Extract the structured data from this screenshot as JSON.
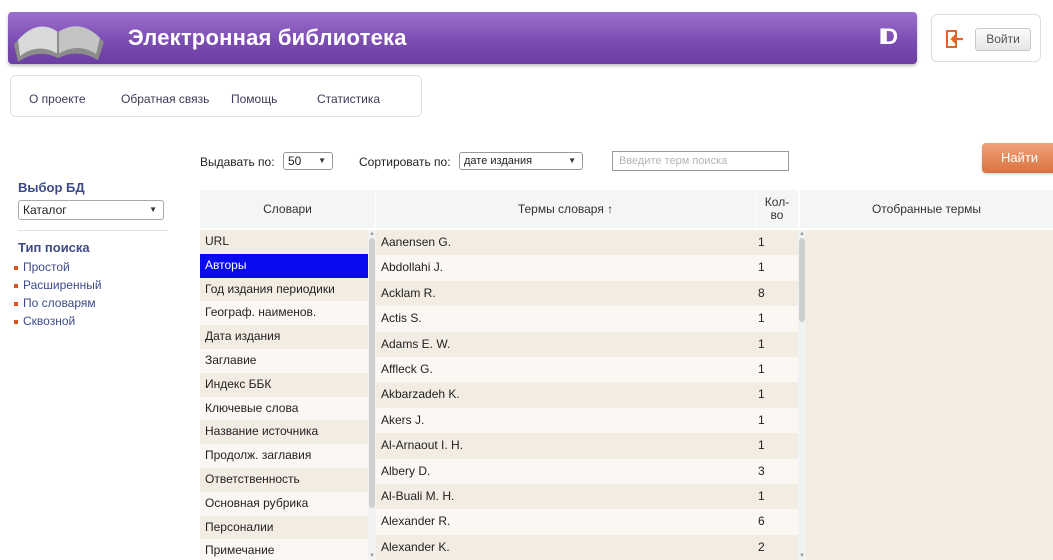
{
  "header": {
    "title": "Электронная библиотека",
    "brand_mark": "ID",
    "login_label": "Войти"
  },
  "nav": {
    "items": [
      "О проекте",
      "Обратная связь",
      "Помощь",
      "Статистика"
    ]
  },
  "sidebar": {
    "db_heading": "Выбор БД",
    "db_selected": "Каталог",
    "search_type_heading": "Тип поиска",
    "search_types": [
      "Простой",
      "Расширенный",
      "По словарям",
      "Сквозной"
    ]
  },
  "controls": {
    "per_page_label": "Выдавать по:",
    "per_page_value": "50",
    "sort_label": "Сортировать по:",
    "sort_value": "дате издания",
    "search_placeholder": "Введите терм поиска",
    "find_label": "Найти"
  },
  "table": {
    "headers": {
      "dictionaries": "Словари",
      "terms": "Термы словаря ↑",
      "count": "Кол-во",
      "selected": "Отобранные термы"
    },
    "dictionaries": [
      "URL",
      "Авторы",
      "Год издания периодики",
      "Географ. наименов.",
      "Дата издания",
      "Заглавие",
      "Индекс ББК",
      "Ключевые слова",
      "Название источника",
      "Продолж. заглавия",
      "Ответственность",
      "Основная рубрика",
      "Персоналии",
      "Примечание"
    ],
    "active_dictionary_index": 1,
    "terms": [
      {
        "name": "Aanensen G.",
        "count": "1"
      },
      {
        "name": "Abdollahi J.",
        "count": "1"
      },
      {
        "name": "Acklam R.",
        "count": "8"
      },
      {
        "name": "Actis S.",
        "count": "1"
      },
      {
        "name": "Adams E. W.",
        "count": "1"
      },
      {
        "name": "Affleck G.",
        "count": "1"
      },
      {
        "name": "Akbarzadeh K.",
        "count": "1"
      },
      {
        "name": "Akers J.",
        "count": "1"
      },
      {
        "name": "Al-Arnaout I. H.",
        "count": "1"
      },
      {
        "name": "Albery D.",
        "count": "3"
      },
      {
        "name": "Al-Buali M. H.",
        "count": "1"
      },
      {
        "name": "Alexander R.",
        "count": "6"
      },
      {
        "name": "Alexander K.",
        "count": "2"
      }
    ]
  },
  "colors": {
    "banner": "#7a4bb0",
    "accent_orange": "#d9733f",
    "active_row": "#0a0aee",
    "link_blue": "#3d4a8a"
  }
}
